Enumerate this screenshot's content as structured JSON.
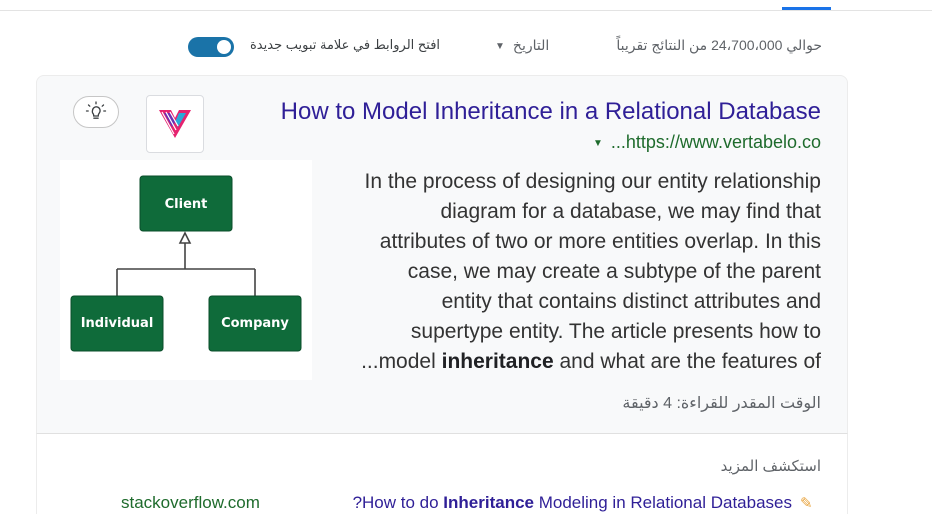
{
  "toolbar": {
    "result_count": "حوالي 24،700،000 من النتائج تقريباً",
    "date_filter_label": "التاريخ",
    "new_tab_label": "افتح الروابط في علامة تبويب جديدة",
    "new_tab_toggle_on": true
  },
  "result": {
    "title": "How to Model Inheritance in a Relational Database",
    "url": "...https://www.vertabelo.co",
    "snippet_lines": [
      "In the process of designing our entity relationship",
      "diagram for a database, we may find that",
      "attributes of two or more entities overlap. In this",
      "case, we may create a subtype of the parent",
      "entity that contains distinct attributes and",
      "supertype entity. The article presents how to"
    ],
    "snippet_last_prefix": "...model ",
    "snippet_last_bold": "inheritance",
    "snippet_last_suffix": " and what are the features of",
    "read_time": "الوقت المقدر للقراءة: 4 دقيقة",
    "diagram": {
      "parent": "Client",
      "child_left": "Individual",
      "child_right": "Company"
    },
    "icons": {
      "lightbulb": "lightbulb-icon",
      "favicon": "vertabelo-logo"
    },
    "colors": {
      "title": "#2f1f97",
      "url": "#1e6b2c",
      "diagram_box": "#0f6b3a"
    }
  },
  "explore": {
    "heading": "استكشف المزيد",
    "link_prefix": "?How to do ",
    "link_bold": "Inheritance",
    "link_suffix": " Modeling in Relational Databases",
    "domain": "stackoverflow.com"
  }
}
